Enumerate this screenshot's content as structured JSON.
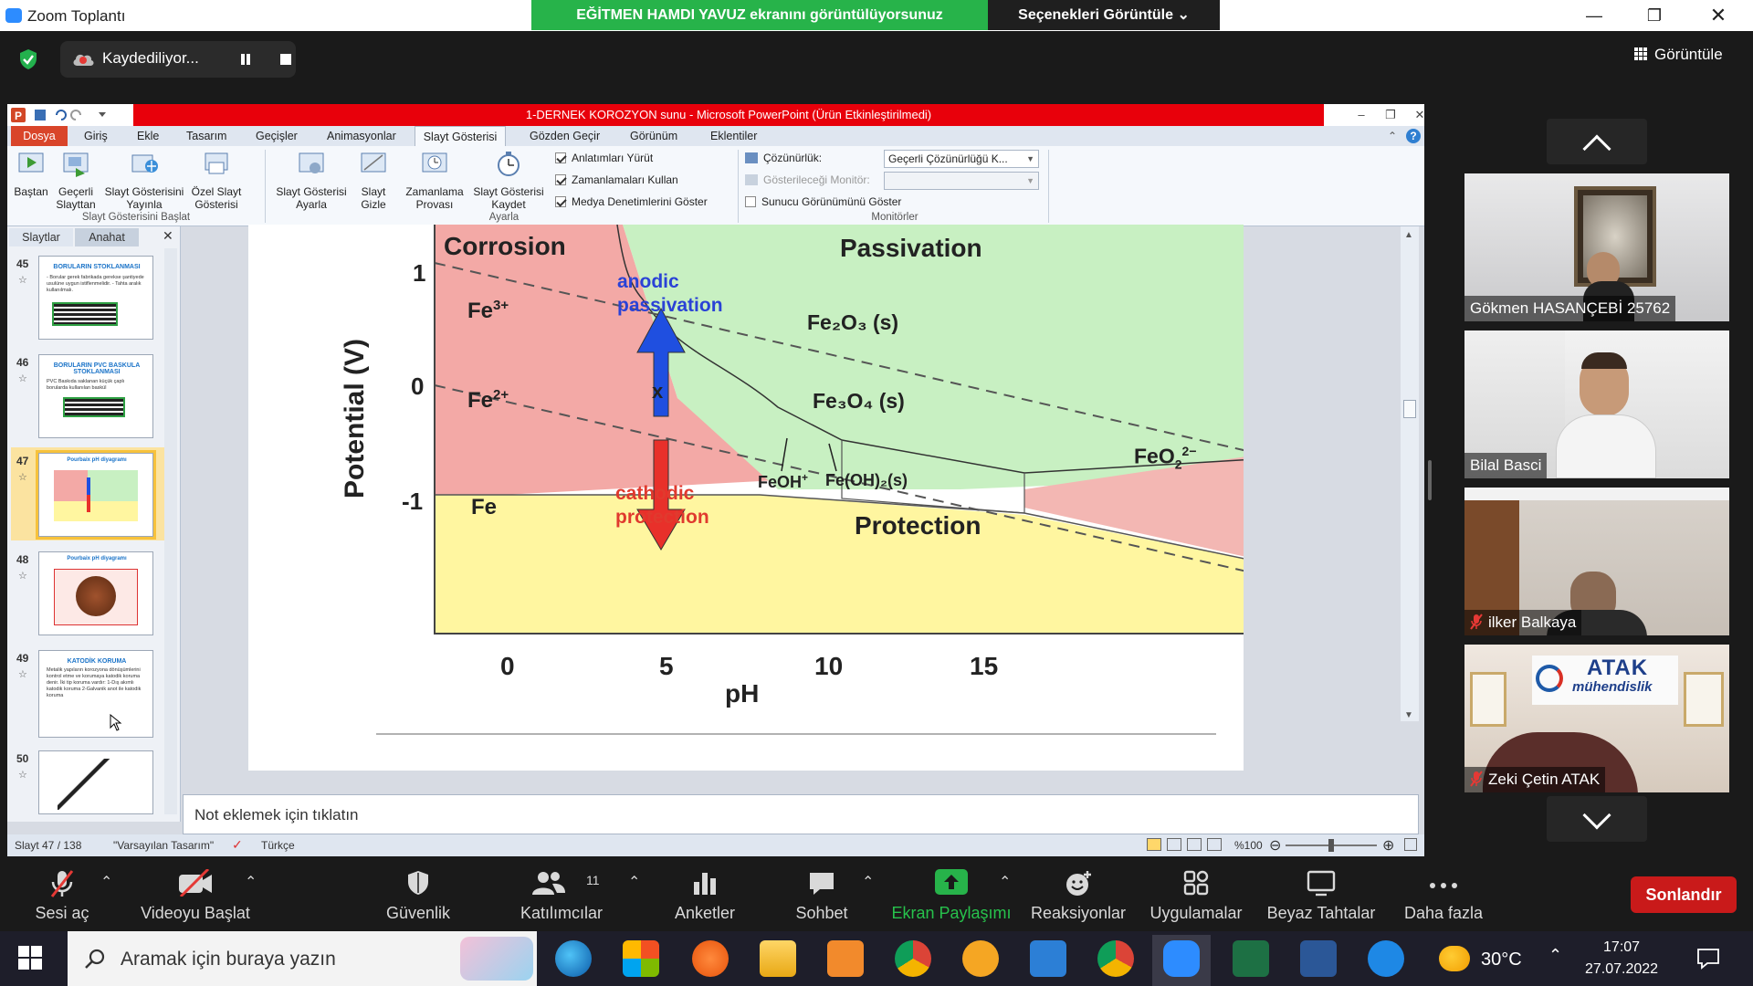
{
  "zoom": {
    "window_title": "Zoom Toplantı",
    "share_banner": "EĞİTMEN HAMDI YAVUZ ekranını görüntülüyorsunuz",
    "view_options": "Seçenekleri Görüntüle ⌄",
    "recording_label": "Kaydediliyor...",
    "view_button": "Görüntüle",
    "participants": [
      {
        "name": "Gökmen HASANÇEBİ 25762",
        "muted": false
      },
      {
        "name": "Bilal Basci",
        "muted": false
      },
      {
        "name": "ilker Balkaya",
        "muted": true
      },
      {
        "name": "Zeki Çetin ATAK",
        "muted": true
      }
    ],
    "tile_logo": {
      "brand": "ATAK",
      "sub": "mühendislik"
    },
    "toolbar": {
      "audio": "Sesi aç",
      "video": "Videoyu Başlat",
      "security": "Güvenlik",
      "participants": "Katılımcılar",
      "participant_count": "11",
      "polls": "Anketler",
      "chat": "Sohbet",
      "share": "Ekran Paylaşımı",
      "reactions": "Reaksiyonlar",
      "apps": "Uygulamalar",
      "whiteboards": "Beyaz Tahtalar",
      "more": "Daha fazla",
      "end": "Sonlandır"
    },
    "colors": {
      "share_green": "#27b34a",
      "end_red": "#c91a1a",
      "pp_red": "#e8000b"
    }
  },
  "ppt": {
    "title": "1-DERNEK KOROZYON sunu - Microsoft PowerPoint (Ürün Etkinleştirilmedi)",
    "tabs": [
      "Dosya",
      "Giriş",
      "Ekle",
      "Tasarım",
      "Geçişler",
      "Animasyonlar",
      "Slayt Gösterisi",
      "Gözden Geçir",
      "Görünüm",
      "Eklentiler"
    ],
    "ribbon": {
      "btn_start": "Baştan",
      "btn_current_1": "Geçerli",
      "btn_current_2": "Slayttan",
      "btn_broadcast_1": "Slayt Gösterisini",
      "btn_broadcast_2": "Yayınla",
      "btn_custom_1": "Özel Slayt",
      "btn_custom_2": "Gösterisi",
      "btn_setup_1": "Slayt Gösterisi",
      "btn_setup_2": "Ayarla",
      "btn_hide_1": "Slayt",
      "btn_hide_2": "Gizle",
      "btn_rehearse_1": "Zamanlama",
      "btn_rehearse_2": "Provası",
      "btn_record_1": "Slayt Gösterisi",
      "btn_record_2": "Kaydet",
      "chk_narration": "Anlatımları Yürüt",
      "chk_timings": "Zamanlamaları Kullan",
      "chk_media": "Medya Denetimlerini Göster",
      "resolution_label": "Çözünürlük:",
      "resolution_value": "Geçerli Çözünürlüğü K...",
      "monitor_label": "Gösterileceği Monitör:",
      "presenter_view": "Sunucu Görünümünü Göster",
      "group_start": "Slayt Gösterisini Başlat",
      "group_setup": "Ayarla",
      "group_monitors": "Monitörler"
    },
    "left_tabs": [
      "Slaytlar",
      "Anahat"
    ],
    "thumbnails": [
      {
        "num": "45",
        "title": "BORULARIN STOKLANMASI",
        "body": "- Borular gerek fabrikada gerekse şantiyede usulüne uygun istiflenmelidir. - Tahta aralık kullanılmalı."
      },
      {
        "num": "46",
        "title": "BORULARIN PVC BASKULA STOKLANMASI",
        "body": "PVC Baskıda saklanan küçük çaplı borularda kullanılan baskül"
      },
      {
        "num": "47",
        "title": "Pourbaix pH diyagramı",
        "body": ""
      },
      {
        "num": "48",
        "title": "Pourbaix pH diyagramı",
        "body": ""
      },
      {
        "num": "49",
        "title": "KATODİK KORUMA",
        "body": "Metalik yapıların korozyona dönüşümlerini kontrol etme ve korumaya katodik koruma denir. İki tip koruma vardır: 1-Dış akımlı katodik koruma 2-Galvanik anot ile katodik koruma"
      },
      {
        "num": "50",
        "title": "",
        "body": ""
      }
    ],
    "notes_placeholder": "Not eklemek için tıklatın",
    "status": {
      "slide": "Slayt 47 / 138",
      "theme": "\"Varsayılan Tasarım\"",
      "lang": "Türkçe",
      "zoom": "%100"
    }
  },
  "chart_data": {
    "type": "diagram",
    "regions": [
      "Corrosion",
      "Passivation",
      "Protection"
    ],
    "species": {
      "fe3": "Fe",
      "fe3_sup": "3+",
      "fe2": "Fe",
      "fe2_sup": "2+",
      "fe": "Fe",
      "fe2o3": "Fe₂O₃ (s)",
      "fe3o4": "Fe₃O₄ (s)",
      "feo2": "FeO",
      "feo2_sub": "2",
      "feo2_sup": "2−",
      "feoh": "FeOH",
      "feoh_sup": "+",
      "feoh2": "Fe(OH)₂(s)"
    },
    "arrows": {
      "up": "anodic passivation",
      "down": "cathodic protection",
      "marker": "x"
    },
    "ylabel": "Potential (V)",
    "xlabel": "pH",
    "x_ticks": [
      "0",
      "5",
      "10",
      "15"
    ],
    "y_ticks": [
      "1",
      "0",
      "-1"
    ],
    "colors": {
      "corrosion": "#f3a9a6",
      "passivation": "#c8f0c2",
      "protection": "#fff6a0",
      "up_arrow": "#1f4fe0",
      "down_arrow": "#e8302a",
      "anodic_text": "#2a42d6",
      "cathodic_text": "#e03a2e"
    }
  },
  "taskbar": {
    "search_placeholder": "Aramak için buraya yazın",
    "temperature": "30°C",
    "time": "17:07",
    "date": "27.07.2022"
  }
}
